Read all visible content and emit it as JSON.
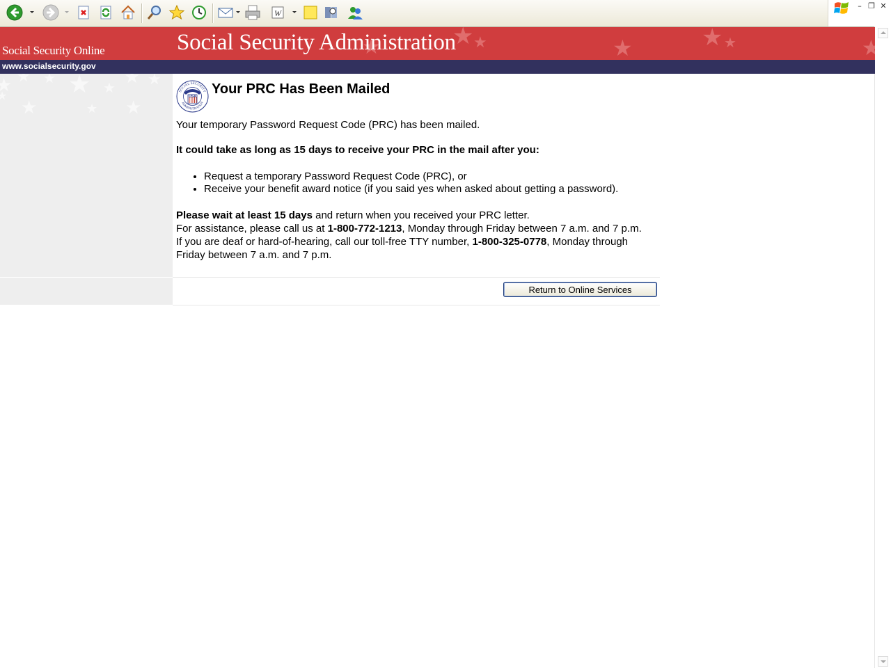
{
  "toolbar": {
    "buttons": [
      "back-icon",
      "forward-icon",
      "stop-icon",
      "refresh-icon",
      "home-icon",
      "search-icon",
      "favorites-icon",
      "history-icon",
      "mail-icon",
      "print-icon",
      "edit-icon",
      "notes-icon",
      "research-icon",
      "messenger-icon"
    ]
  },
  "banner": {
    "left_title": "Social Security Online",
    "main_title": "Social Security Administration",
    "url": "www.socialsecurity.gov",
    "color": "#d03d3e",
    "url_bar_color": "#32315e"
  },
  "seal": {
    "text_top": "SOCIAL SECURITY",
    "text_bottom": "ADMINISTRATION",
    "text_center": "USA"
  },
  "main": {
    "title": "Your PRC Has Been Mailed",
    "intro": "Your temporary Password Request Code (PRC) has been mailed.",
    "warning": "It could take as long as 15 days to receive your PRC in the mail after you:",
    "bullets": [
      "Request a temporary Password Request Code (PRC), or",
      "Receive your benefit award notice (if you said yes when asked about getting a password)."
    ],
    "wait_bold": "Please wait at least 15 days",
    "wait_rest": " and return when you received your PRC letter.",
    "assist_1": "For assistance, please call us at ",
    "phone": "1-800-772-1213",
    "assist_2": ", Monday through Friday between 7 a.m. and 7 p.m. If you are deaf or hard-of-hearing, call our toll-free TTY number, ",
    "tty": "1-800-325-0778",
    "assist_3": ", Monday through Friday between 7 a.m. and 7 p.m.",
    "return_button": "Return to Online Services"
  }
}
